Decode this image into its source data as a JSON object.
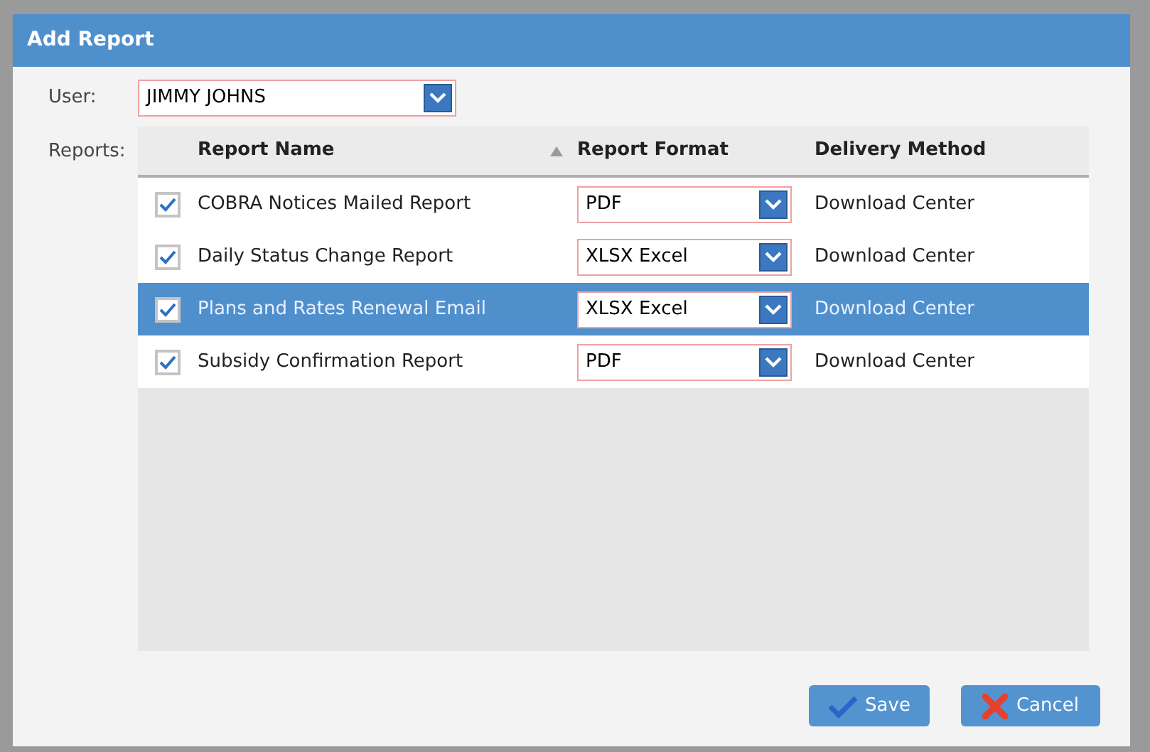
{
  "window": {
    "title": "Add Report"
  },
  "user": {
    "label": "User:",
    "value": "JIMMY JOHNS"
  },
  "reports_label": "Reports:",
  "table": {
    "columns": [
      {
        "label": "Report Name",
        "sorted": true
      },
      {
        "label": "Report Format",
        "sorted": false
      },
      {
        "label": "Delivery Method",
        "sorted": false
      }
    ],
    "rows": [
      {
        "checked": true,
        "selected": false,
        "name": "COBRA Notices Mailed Report",
        "format": "PDF",
        "delivery": "Download Center"
      },
      {
        "checked": true,
        "selected": false,
        "name": "Daily Status Change Report",
        "format": "XLSX Excel",
        "delivery": "Download Center"
      },
      {
        "checked": true,
        "selected": true,
        "name": "Plans and Rates Renewal Email",
        "format": "XLSX Excel",
        "delivery": "Download Center"
      },
      {
        "checked": true,
        "selected": false,
        "name": "Subsidy Confirmation Report",
        "format": "PDF",
        "delivery": "Download Center"
      }
    ]
  },
  "buttons": [
    {
      "kind": "save",
      "label": "Save"
    },
    {
      "kind": "cancel",
      "label": "Cancel"
    }
  ]
}
